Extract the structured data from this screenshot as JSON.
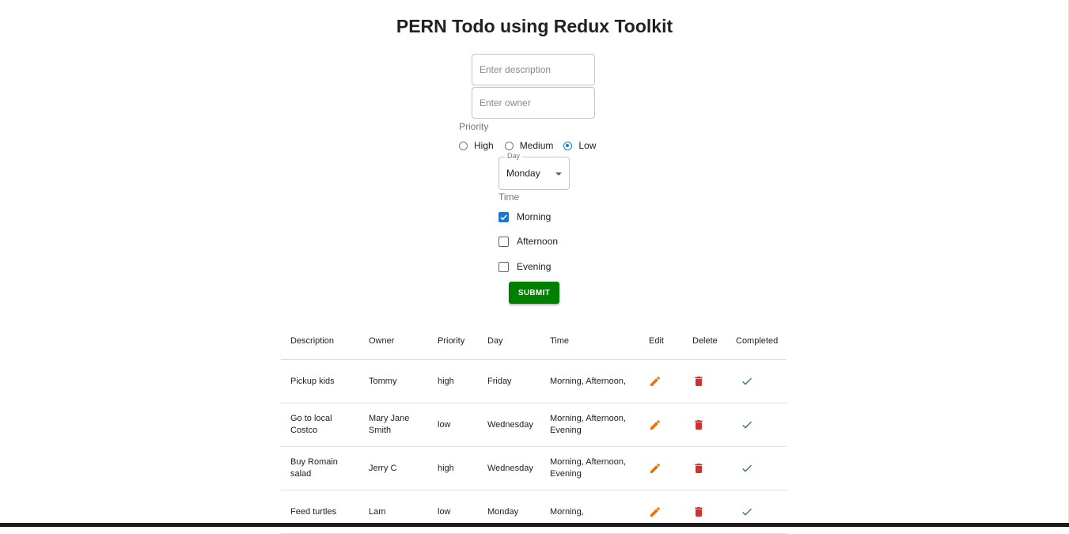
{
  "title": "PERN Todo using Redux Toolkit",
  "form": {
    "description_placeholder": "Enter description",
    "owner_placeholder": "Enter owner",
    "priority_label": "Priority",
    "priority_options": [
      "High",
      "Medium",
      "Low"
    ],
    "priority_selected": "Low",
    "day_label": "Day",
    "day_value": "Monday",
    "time_label": "Time",
    "time_options": [
      {
        "label": "Morning",
        "checked": true
      },
      {
        "label": "Afternoon",
        "checked": false
      },
      {
        "label": "Evening",
        "checked": false
      }
    ],
    "submit_label": "SUBMIT"
  },
  "table": {
    "headers": [
      "Description",
      "Owner",
      "Priority",
      "Day",
      "Time",
      "Edit",
      "Delete",
      "Completed"
    ],
    "rows": [
      {
        "description": "Pickup kids",
        "owner": "Tommy",
        "priority": "high",
        "day": "Friday",
        "time": "Morning, Afternoon,"
      },
      {
        "description": "Go to local Costco",
        "owner": "Mary Jane Smith",
        "priority": "low",
        "day": "Wednesday",
        "time": "Morning, Afternoon, Evening"
      },
      {
        "description": "Buy Romain salad",
        "owner": "Jerry C",
        "priority": "high",
        "day": "Wednesday",
        "time": "Morning, Afternoon, Evening"
      },
      {
        "description": "Feed turtles",
        "owner": "Lam",
        "priority": "low",
        "day": "Monday",
        "time": "Morning,"
      }
    ]
  },
  "icons": {
    "edit": "pencil-icon",
    "delete": "trash-icon",
    "completed": "check-icon"
  },
  "colors": {
    "accent": "#1976d2",
    "submit": "#008000",
    "edit": "#ef6c00",
    "delete": "#d32f2f",
    "completed": "#2e7d32"
  }
}
